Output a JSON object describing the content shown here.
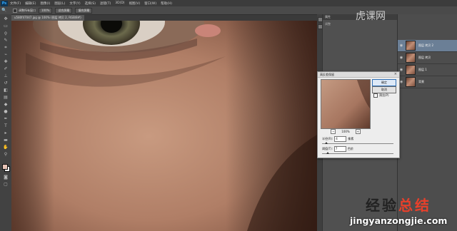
{
  "app": {
    "logo": "Ps"
  },
  "menu": [
    "文件(F)",
    "编辑(E)",
    "图像(I)",
    "图层(L)",
    "文字(Y)",
    "选择(S)",
    "滤镜(T)",
    "3D(D)",
    "视图(V)",
    "窗口(W)",
    "帮助(H)"
  ],
  "options_bar": {
    "button1": "调整所有窗口",
    "button2": "100%",
    "button3": "适合屏幕",
    "button4": "填充屏幕"
  },
  "document_tab": "u580f47047.jpg @ 100% (图层 拷贝 2, RGB/8#)",
  "panels": {
    "header": "属性",
    "sub": "调整"
  },
  "layers": [
    {
      "name": "图层 拷贝 2",
      "selected": true
    },
    {
      "name": "图层 拷贝",
      "selected": false
    },
    {
      "name": "图层 1",
      "selected": false
    },
    {
      "name": "背景",
      "selected": false
    }
  ],
  "dialog": {
    "title": "高反差保留",
    "close": "×",
    "ok_label": "确定",
    "cancel_label": "取消",
    "preview_label": "预览(P)",
    "preview_checked": false,
    "zoom": "100%",
    "zoom_out": "−",
    "zoom_in": "+",
    "radius_label": "半径(R):",
    "radius_value": "4",
    "radius_unit": "像素",
    "threshold_label": "阈值(T):",
    "threshold_value": "7",
    "threshold_unit": "色阶"
  },
  "watermark": {
    "title_part1": "经验",
    "title_part2": "总结",
    "url": "jingyanzongjie.com"
  },
  "brand_overlay": "虎课网",
  "colors": {
    "fg_swatch": "#e7c3b6",
    "bg_swatch": "#f2f2f2",
    "accent": "#2f6fb5"
  }
}
